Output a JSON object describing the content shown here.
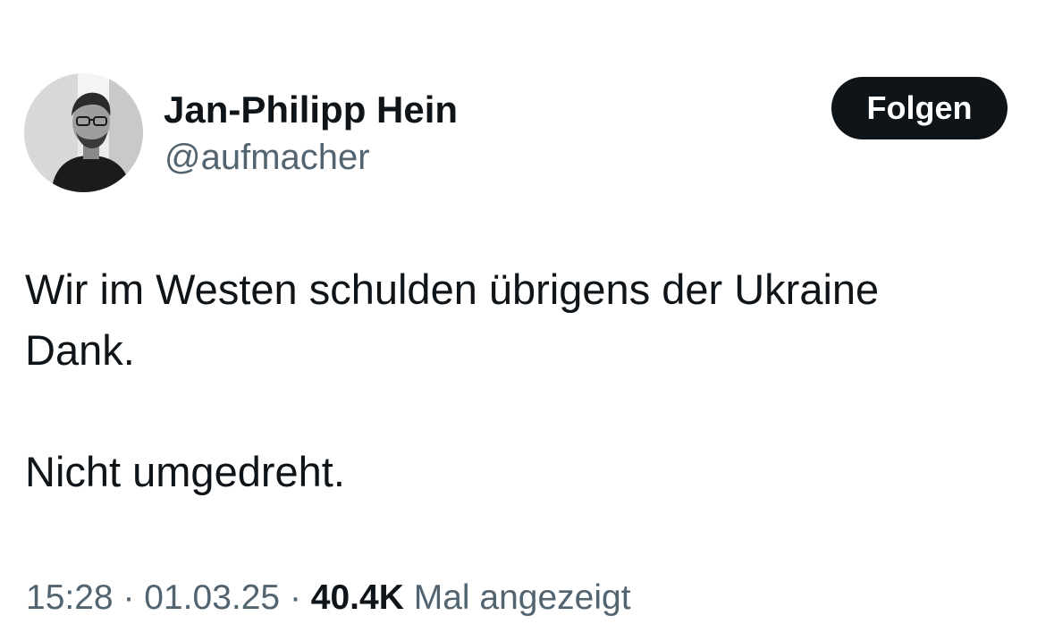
{
  "author": {
    "display_name": "Jan-Philipp Hein",
    "handle": "@aufmacher"
  },
  "follow_button": {
    "label": "Folgen"
  },
  "tweet": {
    "lines": [
      "Wir im Westen schulden übrigens der Ukraine",
      "Dank.",
      "Nicht umgedreht."
    ]
  },
  "meta": {
    "time": "15:28",
    "separator": "·",
    "date": "01.03.25",
    "views_count": "40.4K",
    "views_label": "Mal angezeigt"
  },
  "colors": {
    "text_primary": "#0f1419",
    "text_secondary": "#536471",
    "button_bg": "#0f1419",
    "background": "#ffffff"
  }
}
